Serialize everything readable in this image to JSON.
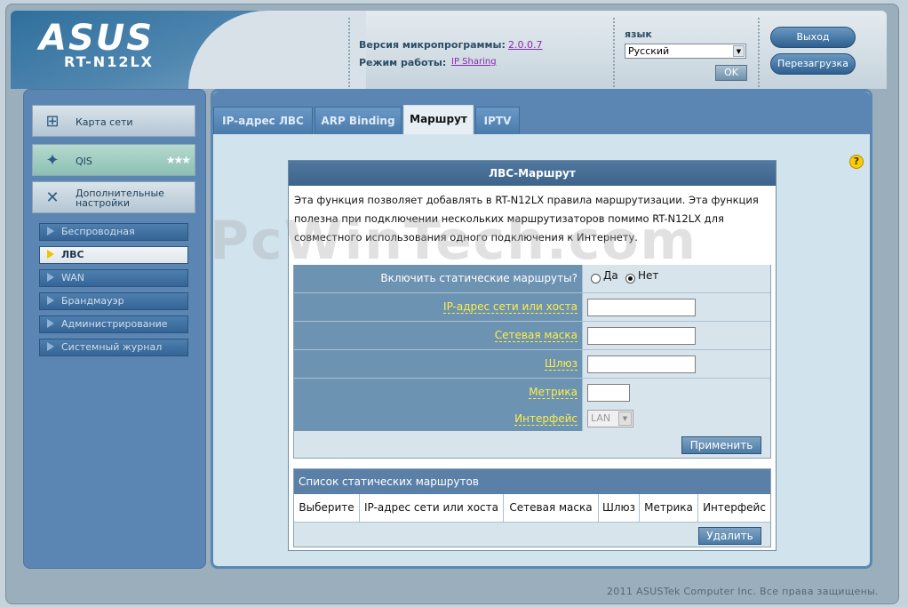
{
  "header": {
    "logo": "ASUS",
    "model": "RT-N12LX",
    "firmware_label": "Версия микропрограммы:",
    "firmware_version": "2.0.0.7",
    "mode_label": "Режим работы:",
    "mode_value": "IP Sharing",
    "lang_label": "язык",
    "lang_value": "Русский",
    "ok_label": "OK",
    "logout_label": "Выход",
    "reboot_label": "Перезагрузка"
  },
  "sidebar": {
    "main": [
      {
        "label": "Карта сети",
        "icon": "network-map-icon"
      },
      {
        "label": "QIS",
        "icon": "wand-icon"
      },
      {
        "label": "Дополнительные настройки",
        "icon": "wrench-icon"
      }
    ],
    "sub": [
      {
        "label": "Беспроводная"
      },
      {
        "label": "ЛВС"
      },
      {
        "label": "WAN"
      },
      {
        "label": "Брандмауэр"
      },
      {
        "label": "Администрирование"
      },
      {
        "label": "Системный журнал"
      }
    ]
  },
  "tabs": [
    {
      "label": "IP-адрес ЛВС"
    },
    {
      "label": "ARP Binding"
    },
    {
      "label": "Маршрут"
    },
    {
      "label": "IPTV"
    }
  ],
  "panel": {
    "title": "ЛВС-Маршрут",
    "description": "Эта функция позволяет добавлять в RT-N12LX правила маршрутизации. Эта функция полезна при подключении нескольких маршрутизаторов помимо RT-N12LX для совместного использования одного подключения к Интернету.",
    "watermark": "PcWinTech.com",
    "form": {
      "static_label": "Включить статические маршруты?",
      "yes": "Да",
      "no": "Нет",
      "ip_label": "IP-адрес сети или хоста",
      "mask_label": "Сетевая маска",
      "gateway_label": "Шлюз",
      "metric_label": "Метрика",
      "iface_label": "Интерфейс",
      "iface_value": "LAN",
      "apply": "Применить"
    },
    "list": {
      "title": "Список статических маршрутов",
      "columns": [
        "Выберите",
        "IP-адрес сети или хоста",
        "Сетевая маска",
        "Шлюз",
        "Метрика",
        "Интерфейс"
      ],
      "delete": "Удалить"
    }
  },
  "footer": "2011 ASUSTek Computer Inc. Все права защищены."
}
